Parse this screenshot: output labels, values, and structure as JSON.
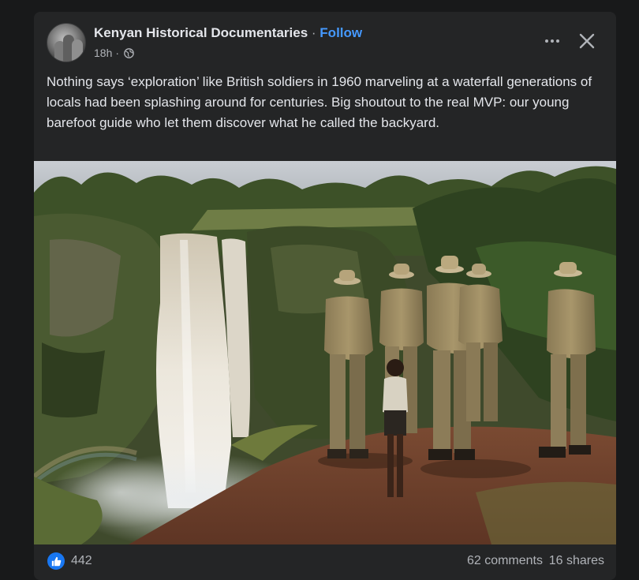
{
  "post": {
    "page_name": "Kenyan Historical Documentaries",
    "separator": "·",
    "follow_label": "Follow",
    "timestamp": "18h",
    "meta_separator": "·",
    "privacy_icon": "globe-icon",
    "caption": "Nothing says ‘exploration’ like British soldiers in 1960 marveling at a waterfall generations of locals had been splashing around for centuries. Big shoutout to the real MVP: our young barefoot guide who let them discover what he called the backyard.",
    "photo_icon": "photo-waterfall-soldiers"
  },
  "actions": {
    "more_icon": "more-dots-icon",
    "close_icon": "close-icon"
  },
  "reactions": {
    "icon": "like-icon",
    "count": "442",
    "comments": "62 comments",
    "shares": "16 shares"
  },
  "colors": {
    "background": "#18191a",
    "card": "#242526",
    "text_primary": "#e4e6eb",
    "text_secondary": "#b0b3b8",
    "follow": "#4599ff",
    "like": "#1877f2"
  }
}
